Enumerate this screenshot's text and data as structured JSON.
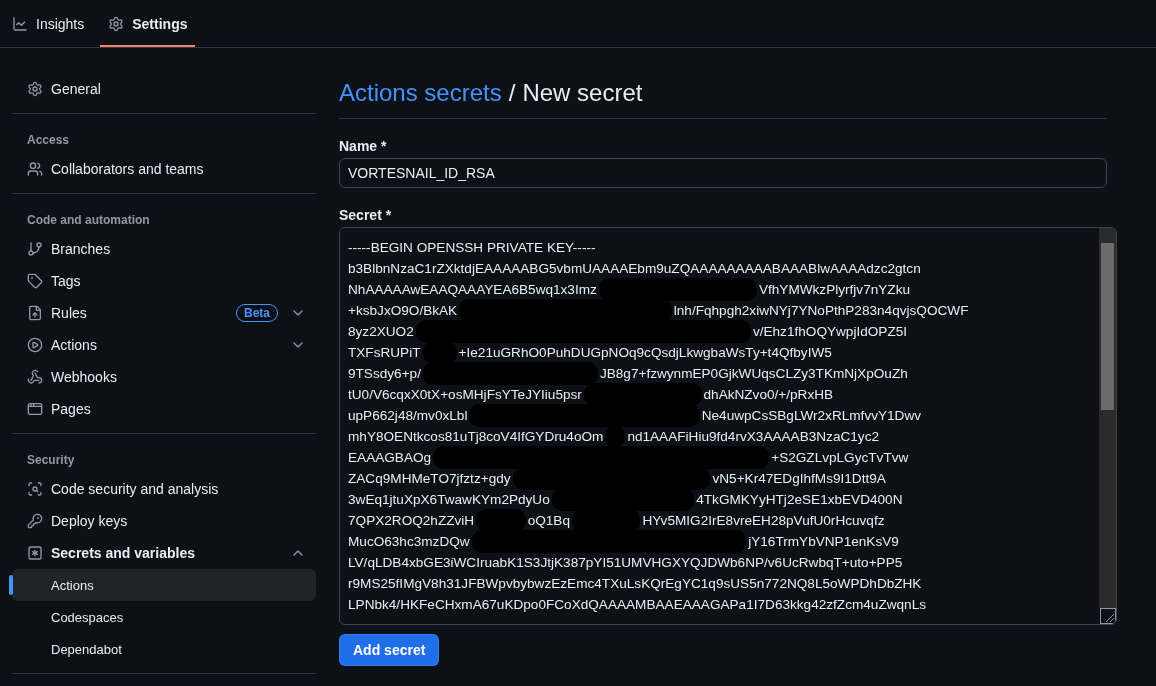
{
  "nav_tabs": [
    {
      "label": "Insights",
      "selected": false
    },
    {
      "label": "Settings",
      "selected": true
    }
  ],
  "sidebar": {
    "sections": [
      {
        "items": [
          {
            "label": "General",
            "selected": false
          }
        ]
      },
      {
        "heading": "Access",
        "items": [
          {
            "label": "Collaborators and teams",
            "selected": false
          }
        ]
      },
      {
        "heading": "Code and automation",
        "items": [
          {
            "label": "Branches",
            "selected": false
          },
          {
            "label": "Tags",
            "selected": false
          },
          {
            "label": "Rules",
            "selected": false,
            "badge": "Beta",
            "expanded": false
          },
          {
            "label": "Actions",
            "selected": false,
            "expanded": false
          },
          {
            "label": "Webhooks",
            "selected": false
          },
          {
            "label": "Pages",
            "selected": false
          }
        ]
      },
      {
        "heading": "Security",
        "items": [
          {
            "label": "Code security and analysis",
            "selected": false
          },
          {
            "label": "Deploy keys",
            "selected": false
          },
          {
            "label": "Secrets and variables",
            "selected": false,
            "expanded": true,
            "children": [
              {
                "label": "Actions",
                "selected": true
              },
              {
                "label": "Codespaces",
                "selected": false
              },
              {
                "label": "Dependabot",
                "selected": false
              }
            ]
          }
        ]
      }
    ]
  },
  "page_title": {
    "link": "Actions secrets",
    "separator": "/",
    "current": "New secret"
  },
  "name_field": {
    "label": "Name *",
    "value": "VORTESNAIL_ID_RSA"
  },
  "secret_field": {
    "label": "Secret *",
    "lines": [
      [
        "-----BEGIN OPENSSH PRIVATE KEY-----"
      ],
      [
        "b3BlbnNzaC1rZXktdjEAAAAABG5vbmUAAAAEbm9uZQAAAAAAAAABAAABlwAAAAdzc2gtcn"
      ],
      [
        "NhAAAAAwEAAQAAAYEA6B5wq1x3Imz",
        "VfhYMWkzPlyrfjv7nYZku"
      ],
      [
        "+ksbJxO9O/BkAK",
        "lnh/Fqhpgh2xiwNYj7YNoPthP283n4qvjsQOCWF"
      ],
      [
        "8yz2XUO2",
        "v/Ehz1fhOQYwpjIdOPZ5I"
      ],
      [
        "TXFsRUPiT",
        "+Ie21uGRhO0PuhDUGpNOq9cQsdjLkwgbaWsTy+t4QfbyIW5"
      ],
      [
        "9TSsdy6+p/",
        "JB8g7+fzwynmEP0GjkWUqsCLZy3TKmNjXpOuZh"
      ],
      [
        "tU0/V6cqxX0tX+osMHjFsYTeJYIiu5psr",
        "dhAkNZvo0/+/pRxHB"
      ],
      [
        "upP662j48/mv0xLbl",
        "Ne4uwpCsSBgLWr2xRLmfvvY1Dwv"
      ],
      [
        "mhY8OENtkcos81uTj8coV4IfGYDru4oOm",
        "nd1AAAFiHiu9fd4rvX3AAAAB3NzaC1yc2"
      ],
      [
        "EAAAGBAOg",
        "+S2GZLvpLGycTvTvw"
      ],
      [
        "ZACq9MHMeTO7jfztz+gdy",
        "vN5+Kr47EDgIhfMs9I1Dtt9A"
      ],
      [
        "3wEq1jtuXpX6TwawKYm2PdyUo",
        "4TkGMKYyHTj2eSE1xbEVD400N"
      ],
      [
        "7QPX2ROQ2hZZviH",
        "oQ1Bq",
        "HYv5MIG2IrE8vreEH28pVufU0rHcuvqfz"
      ],
      [
        "MucO63hc3mzDQw",
        "jY16TrmYbVNP1enKsV9"
      ],
      [
        "LV/qLDB4xbGE3iWCIruabK1S3JtjK387pYI51UMVHGXYQJDWb6NP/v6UcRwbqT+uto+PP5"
      ],
      [
        "r9MS25fIMgV8h31JFBWpvbybwzEzEmc4TXuLsKQrEgYC1q9sUS5n772NQ8L5oWPDhDbZHK"
      ],
      [
        "LPNbk4/HKFeCHxmA67uKDpo0FCoXdQAAAAMBAAEAAAGAPa1I7D63kkg42zfZcm4uZwqnLs"
      ]
    ]
  },
  "submit_button": "Add secret"
}
